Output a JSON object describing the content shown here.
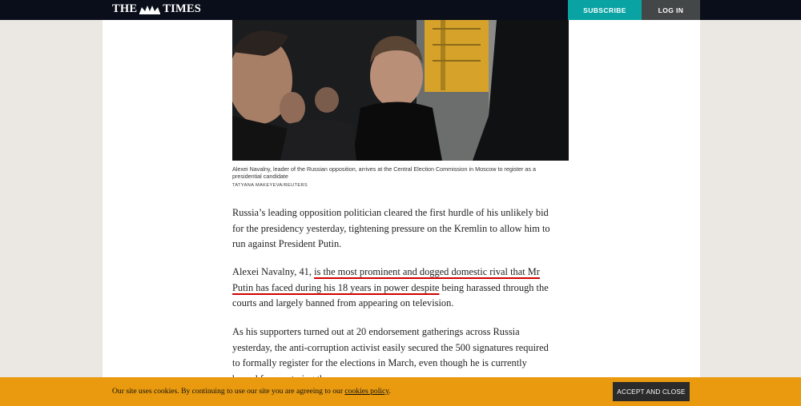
{
  "header": {
    "logo_left": "THE",
    "logo_right": "TIMES",
    "subscribe_label": "SUBSCRIBE",
    "login_label": "LOG IN"
  },
  "article": {
    "image_caption_lines": [
      "Alexei Navalny, leader of the Russian opposition, arrives at the Central Election Commission in Moscow to register as a",
      "presidential candidate"
    ],
    "image_credit": "TATYANA MAKEYEVA/REUTERS",
    "para1_lines": [
      "Russia’s leading opposition politician cleared the first hurdle of his unlikely bid",
      "for the presidency yesterday, tightening pressure on the Kremlin to allow him to",
      "run against President Putin."
    ],
    "para2": {
      "l1_a": "Alexei Navalny, 41, ",
      "l1_b": "is the most prominent and dogged domestic rival that Mr",
      "l2_a": "Putin has faced during his 18 years in power despite",
      "l2_b": " being harassed through the",
      "l3": "courts and largely banned from appearing on television."
    },
    "para3_lines": [
      "As his supporters turned out at 20 endorsement gatherings across Russia",
      "yesterday, the anti-corruption activist easily secured the 500 signatures required",
      "to formally register for the elections in March, even though he is currently",
      "barred from entering them."
    ]
  },
  "cookie_banner": {
    "text": "Our site uses cookies. By continuing to use our site you are agreeing to our ",
    "link": "cookies policy",
    "period": ".",
    "accept_label": "ACCEPT AND CLOSE"
  },
  "colors": {
    "topbar": "#0a0e1a",
    "subscribe": "#0aa3a3",
    "login": "#444748",
    "cookie_bar": "#e99a0f",
    "highlight_underline": "#d00000"
  }
}
